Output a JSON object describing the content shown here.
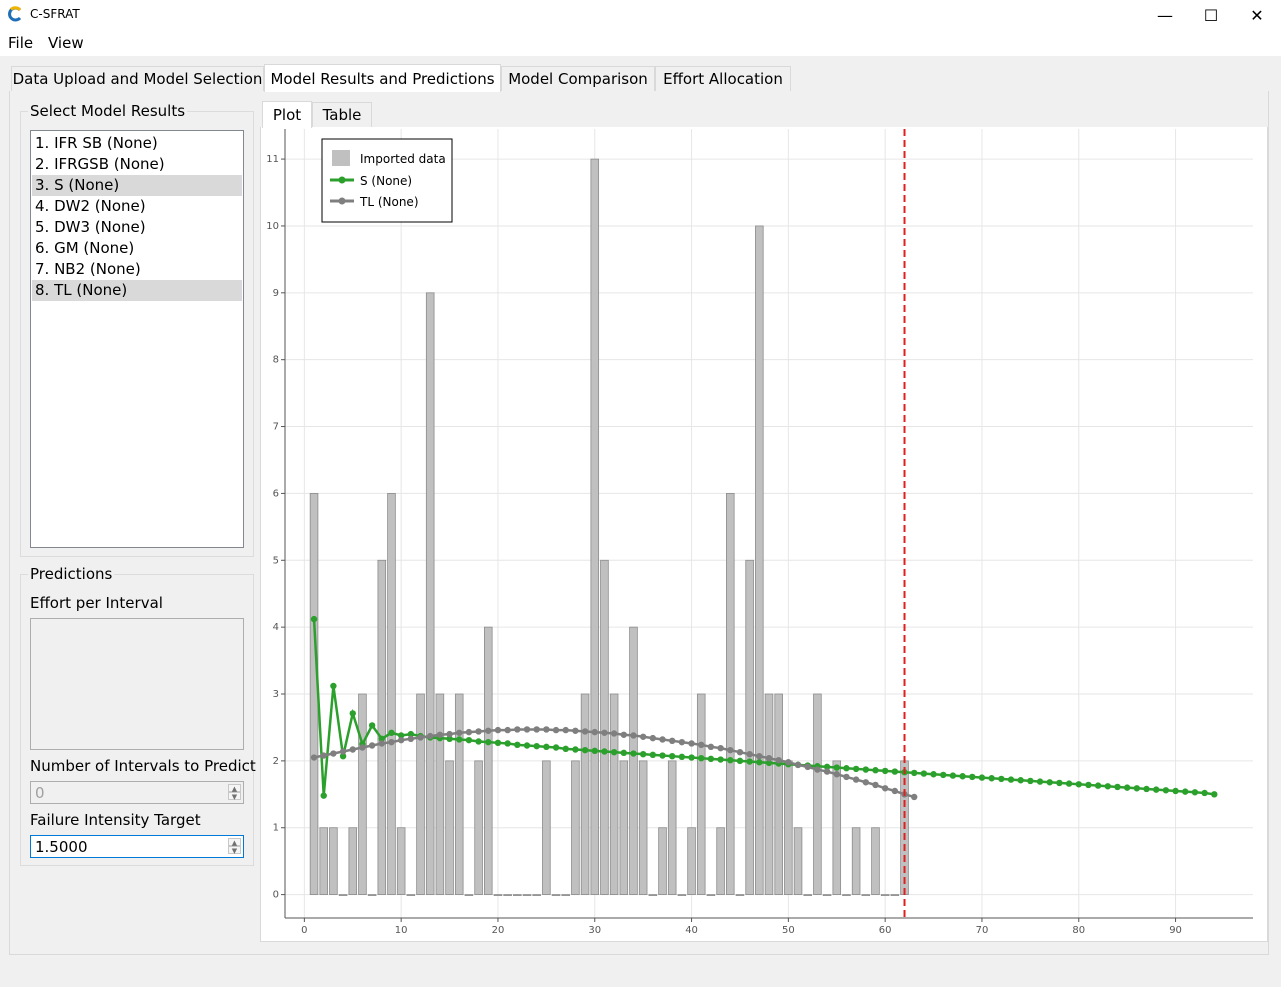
{
  "window": {
    "title": "C-SFRAT",
    "minimize": "—",
    "maximize": "☐",
    "close": "✕"
  },
  "menu": [
    "File",
    "View"
  ],
  "tabs": [
    "Data Upload and Model Selection",
    "Model Results and Predictions",
    "Model Comparison",
    "Effort Allocation"
  ],
  "active_tab": 1,
  "left": {
    "select_title": "Select Model Results",
    "models": [
      "1. IFR SB (None)",
      "2. IFRGSB (None)",
      "3. S (None)",
      "4. DW2 (None)",
      "5. DW3 (None)",
      "6. GM (None)",
      "7. NB2 (None)",
      "8. TL (None)"
    ],
    "selected": [
      2,
      7
    ],
    "predictions_title": "Predictions",
    "effort_label": "Effort per Interval",
    "intervals_label": "Number of Intervals to Predict",
    "intervals_value": "0",
    "intensity_label": "Failure Intensity Target",
    "intensity_value": "1.5000"
  },
  "plot_tabs": [
    "Plot",
    "Table"
  ],
  "colors": {
    "bar": "#c0c0c0",
    "bar_edge": "#8c8c8c",
    "s": "#2ca02c",
    "tl": "#7f7f7f",
    "cutoff": "#e02020"
  },
  "chart_data": {
    "type": "bar",
    "xlim": [
      -2,
      98
    ],
    "ylim": [
      -0.35,
      11.45
    ],
    "xticks": [
      0,
      10,
      20,
      30,
      40,
      50,
      60,
      70,
      80,
      90
    ],
    "yticks": [
      0,
      1,
      2,
      3,
      4,
      5,
      6,
      7,
      8,
      9,
      10,
      11
    ],
    "grid": true,
    "legend_position": "top-left",
    "cutoff_x": 62,
    "legend": [
      "Imported data",
      "S (None)",
      "TL (None)"
    ],
    "bars": {
      "name": "Imported data",
      "x": [
        1,
        2,
        3,
        4,
        5,
        6,
        7,
        8,
        9,
        10,
        11,
        12,
        13,
        14,
        15,
        16,
        17,
        18,
        19,
        20,
        21,
        22,
        23,
        24,
        25,
        26,
        27,
        28,
        29,
        30,
        31,
        32,
        33,
        34,
        35,
        36,
        37,
        38,
        39,
        40,
        41,
        42,
        43,
        44,
        45,
        46,
        47,
        48,
        49,
        50,
        51,
        52,
        53,
        54,
        55,
        56,
        57,
        58,
        59,
        60,
        61,
        62
      ],
      "values": [
        6,
        1,
        1,
        0,
        1,
        3,
        0,
        5,
        6,
        1,
        0,
        3,
        9,
        3,
        2,
        3,
        0,
        2,
        4,
        0,
        0,
        0,
        0,
        0,
        2,
        0,
        0,
        2,
        3,
        11,
        5,
        3,
        2,
        4,
        2,
        0,
        1,
        2,
        0,
        1,
        3,
        0,
        1,
        6,
        0,
        5,
        10,
        3,
        3,
        2,
        1,
        0,
        3,
        0,
        2,
        0,
        1,
        0,
        1,
        0,
        0,
        2
      ]
    },
    "series": [
      {
        "name": "S (None)",
        "x": [
          1,
          2,
          3,
          4,
          5,
          6,
          7,
          8,
          9,
          10,
          11,
          12,
          13,
          14,
          15,
          16,
          17,
          18,
          19,
          20,
          21,
          22,
          23,
          24,
          25,
          26,
          27,
          28,
          29,
          30,
          31,
          32,
          33,
          34,
          35,
          36,
          37,
          38,
          39,
          40,
          41,
          42,
          43,
          44,
          45,
          46,
          47,
          48,
          49,
          50,
          51,
          52,
          53,
          54,
          55,
          56,
          57,
          58,
          59,
          60,
          61,
          62,
          63,
          64,
          65,
          66,
          67,
          68,
          69,
          70,
          71,
          72,
          73,
          74,
          75,
          76,
          77,
          78,
          79,
          80,
          81,
          82,
          83,
          84,
          85,
          86,
          87,
          88,
          89,
          90,
          91,
          92,
          93,
          94
        ],
        "values": [
          4.12,
          1.48,
          3.12,
          2.07,
          2.71,
          2.25,
          2.53,
          2.33,
          2.42,
          2.38,
          2.4,
          2.37,
          2.35,
          2.34,
          2.33,
          2.32,
          2.31,
          2.29,
          2.28,
          2.27,
          2.26,
          2.24,
          2.23,
          2.22,
          2.21,
          2.2,
          2.18,
          2.17,
          2.16,
          2.15,
          2.14,
          2.13,
          2.12,
          2.11,
          2.1,
          2.09,
          2.08,
          2.07,
          2.06,
          2.05,
          2.04,
          2.03,
          2.02,
          2.01,
          2.0,
          1.99,
          1.98,
          1.97,
          1.96,
          1.95,
          1.94,
          1.93,
          1.92,
          1.91,
          1.9,
          1.89,
          1.88,
          1.87,
          1.86,
          1.85,
          1.84,
          1.83,
          1.82,
          1.81,
          1.8,
          1.79,
          1.78,
          1.77,
          1.76,
          1.75,
          1.74,
          1.73,
          1.72,
          1.71,
          1.7,
          1.69,
          1.68,
          1.67,
          1.66,
          1.65,
          1.64,
          1.63,
          1.62,
          1.61,
          1.6,
          1.59,
          1.58,
          1.57,
          1.56,
          1.55,
          1.54,
          1.53,
          1.52,
          1.5
        ]
      },
      {
        "name": "TL (None)",
        "x": [
          1,
          2,
          3,
          4,
          5,
          6,
          7,
          8,
          9,
          10,
          11,
          12,
          13,
          14,
          15,
          16,
          17,
          18,
          19,
          20,
          21,
          22,
          23,
          24,
          25,
          26,
          27,
          28,
          29,
          30,
          31,
          32,
          33,
          34,
          35,
          36,
          37,
          38,
          39,
          40,
          41,
          42,
          43,
          44,
          45,
          46,
          47,
          48,
          49,
          50,
          51,
          52,
          53,
          54,
          55,
          56,
          57,
          58,
          59,
          60,
          61,
          62,
          63
        ],
        "values": [
          2.05,
          2.08,
          2.11,
          2.14,
          2.17,
          2.2,
          2.23,
          2.26,
          2.28,
          2.31,
          2.33,
          2.35,
          2.37,
          2.39,
          2.4,
          2.42,
          2.43,
          2.44,
          2.45,
          2.46,
          2.46,
          2.47,
          2.47,
          2.47,
          2.47,
          2.46,
          2.46,
          2.45,
          2.44,
          2.43,
          2.42,
          2.41,
          2.39,
          2.38,
          2.36,
          2.34,
          2.32,
          2.3,
          2.28,
          2.26,
          2.24,
          2.21,
          2.19,
          2.16,
          2.13,
          2.1,
          2.07,
          2.04,
          2.01,
          1.98,
          1.94,
          1.91,
          1.87,
          1.84,
          1.8,
          1.76,
          1.72,
          1.68,
          1.64,
          1.59,
          1.55,
          1.5,
          1.46
        ]
      }
    ]
  }
}
